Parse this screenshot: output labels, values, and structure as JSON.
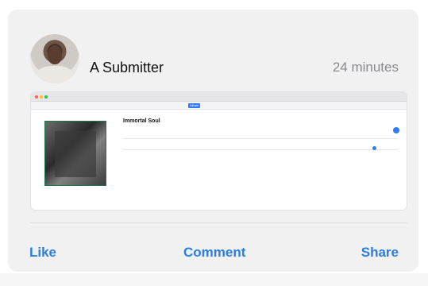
{
  "post": {
    "author": "A Submitter",
    "time": "24 minutes"
  },
  "shared_screenshot": {
    "album_title": "Immortal Soul",
    "artist": "",
    "tabs": [
      "Album",
      "",
      "",
      "",
      ""
    ],
    "active_tab_index": 0
  },
  "actions": {
    "like": "Like",
    "comment": "Comment",
    "share": "Share"
  },
  "colors": {
    "action_blue": "#2a7de1",
    "card_bg": "#f1f1f2",
    "time_gray": "#8a8a8e"
  }
}
